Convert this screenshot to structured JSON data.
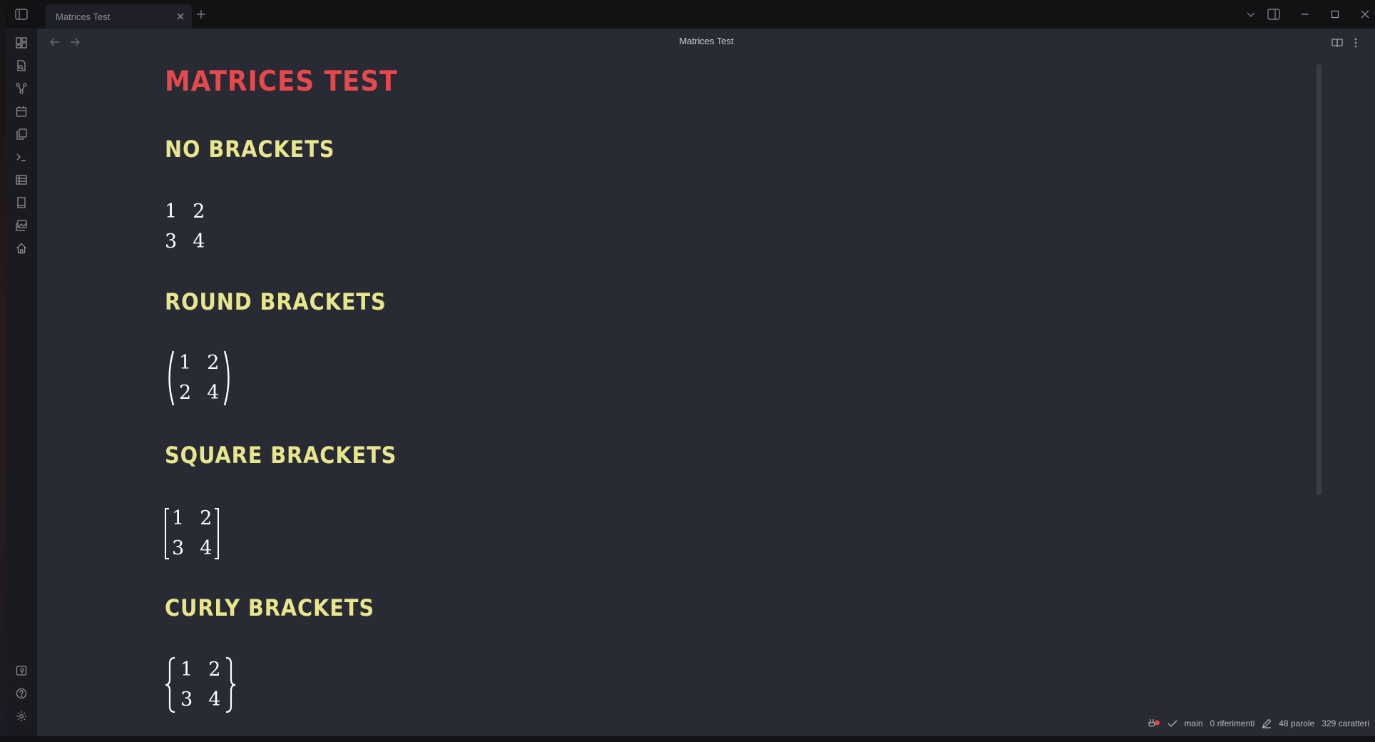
{
  "tab": {
    "title": "Matrices Test"
  },
  "view": {
    "title": "Matrices Test"
  },
  "document": {
    "title": "MATRICES TEST",
    "sections": [
      {
        "heading": "NO BRACKETS",
        "bracket": "none",
        "matrix": [
          [
            "1",
            "2"
          ],
          [
            "3",
            "4"
          ]
        ]
      },
      {
        "heading": "ROUND BRACKETS",
        "bracket": "round",
        "matrix": [
          [
            "1",
            "2"
          ],
          [
            "2",
            "4"
          ]
        ]
      },
      {
        "heading": "SQUARE BRACKETS",
        "bracket": "square",
        "matrix": [
          [
            "1",
            "2"
          ],
          [
            "3",
            "4"
          ]
        ]
      },
      {
        "heading": "CURLY BRACKETS",
        "bracket": "curly",
        "matrix": [
          [
            "1",
            "2"
          ],
          [
            "3",
            "4"
          ]
        ]
      }
    ]
  },
  "statusbar": {
    "branch": "main",
    "backlinks": "0 riferimenti",
    "words": "48 parole",
    "chars": "329 caratteri"
  },
  "ribbon_icons": [
    "dashboard-icon",
    "file-search-icon",
    "graph-view-icon",
    "calendar-icon",
    "copy-icon",
    "terminal-icon",
    "table-icon",
    "book-icon",
    "gallery-icon",
    "home-icon",
    "vault-switch-icon",
    "help-icon",
    "settings-icon"
  ],
  "colors": {
    "title": "#e5484d",
    "heading": "#e8e68c",
    "background": "#292b34"
  }
}
